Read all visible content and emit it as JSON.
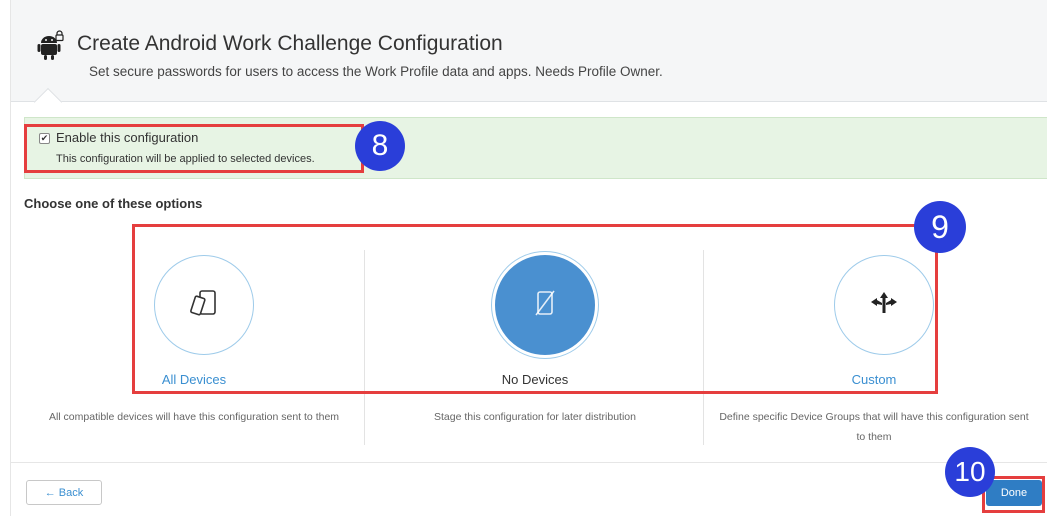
{
  "header": {
    "title": "Create Android Work Challenge Configuration",
    "subtitle": "Set secure passwords for users to access the Work Profile data and apps. Needs Profile Owner.",
    "icon": "android-lock-icon"
  },
  "enable": {
    "checked": true,
    "label": "Enable this configuration",
    "description": "This configuration will be applied to selected devices."
  },
  "choose_label": "Choose one of these options",
  "options": [
    {
      "title": "All Devices",
      "description": "All compatible devices will have this configuration sent to them",
      "icon": "devices-icon",
      "selected": false
    },
    {
      "title": "No Devices",
      "description": "Stage this configuration for later distribution",
      "icon": "no-device-icon",
      "selected": true
    },
    {
      "title": "Custom",
      "description": "Define specific Device Groups that will have this configuration sent to them",
      "icon": "split-arrows-icon",
      "selected": false
    }
  ],
  "footer": {
    "back_label": "← Back",
    "done_label": "Done"
  },
  "annotations": {
    "badge_8": "8",
    "badge_9": "9",
    "badge_10": "10"
  },
  "colors": {
    "accent": "#2f7dc4",
    "link": "#3a8fd1",
    "selected_circle": "#4a90d0",
    "success_bg": "#e7f4e4",
    "highlight": "#e53e3e",
    "badge": "#2a3ed9"
  }
}
